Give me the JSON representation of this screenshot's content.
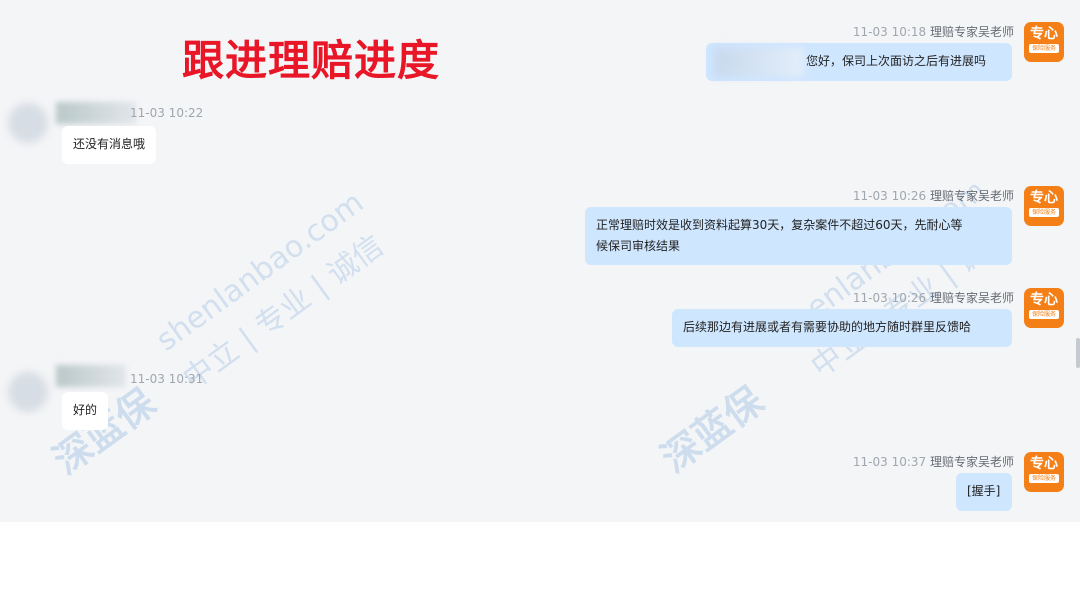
{
  "overlay_title": "跟进理赔进度",
  "watermark": {
    "domain": "shenlanbao.com",
    "slogan": "中立 | 专业 | 诚信",
    "logo": "深蓝保"
  },
  "badge": {
    "main": "专心",
    "sub": "保险服务"
  },
  "messages": [
    {
      "side": "right",
      "time": "11-03 10:18",
      "sender": "理赔专家吴老师",
      "text": "您好，保司上次面访之后有进展吗"
    },
    {
      "side": "left",
      "time": "11-03 10:22",
      "text": "还没有消息哦"
    },
    {
      "side": "right",
      "time": "11-03 10:26",
      "sender": "理赔专家吴老师",
      "text_line1": "正常理赔时效是收到资料起算30天，复杂案件不超过60天，先耐心等",
      "text_line2": "候保司审核结果"
    },
    {
      "side": "right",
      "time": "11-03 10:26",
      "sender": "理赔专家吴老师",
      "text": "后续那边有进展或者有需要协助的地方随时群里反馈哈"
    },
    {
      "side": "left",
      "time": "11-03 10:31",
      "text": "好的"
    },
    {
      "side": "right",
      "time": "11-03 10:37",
      "sender": "理赔专家吴老师",
      "text": "[握手]"
    }
  ]
}
